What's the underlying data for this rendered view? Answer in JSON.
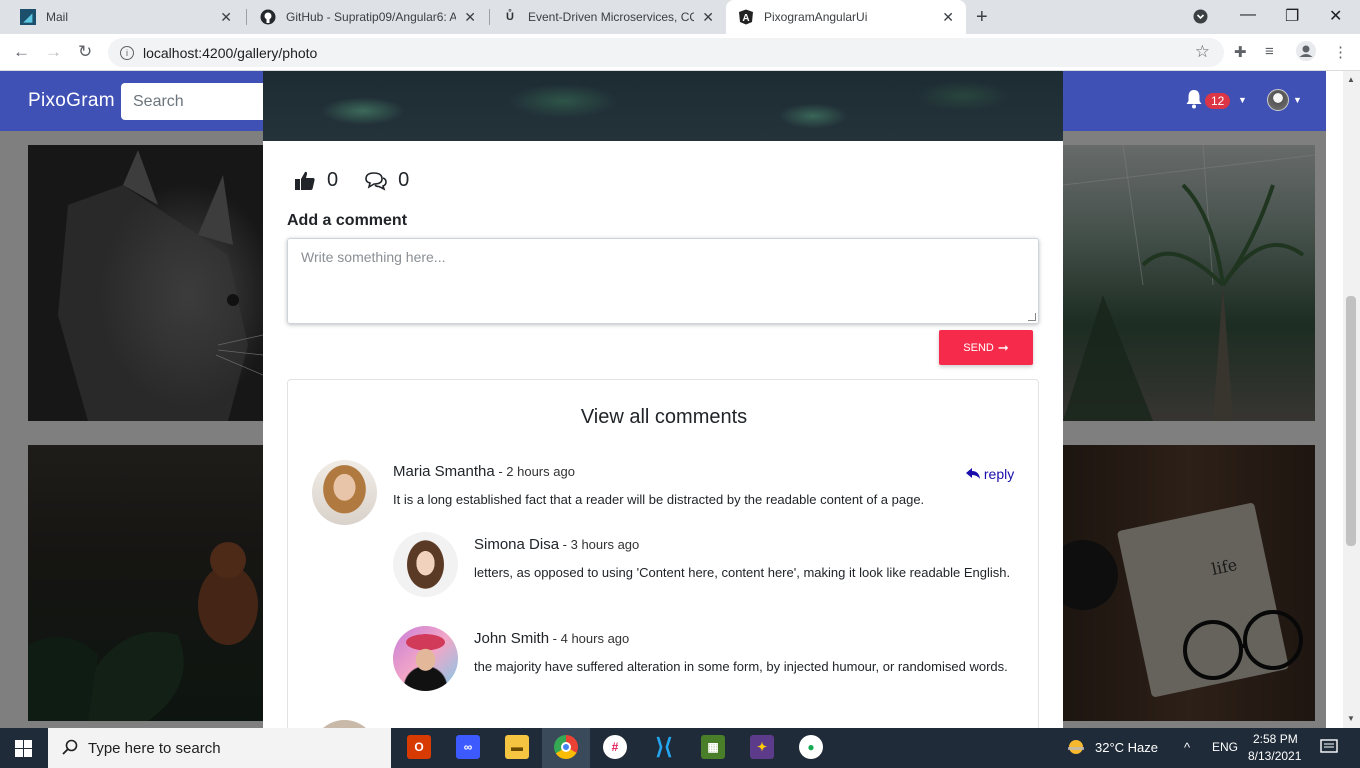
{
  "browser": {
    "tabs": [
      {
        "title": "Mail",
        "icon": "mail-icon",
        "active": false
      },
      {
        "title": "GitHub - Supratip09/Angular6: A",
        "icon": "github-icon",
        "active": false
      },
      {
        "title": "Event-Driven Microservices, CQR",
        "icon": "udemy-icon",
        "active": false
      },
      {
        "title": "PixogramAngularUi",
        "icon": "angular-icon",
        "active": true
      }
    ],
    "url": "localhost:4200/gallery/photo"
  },
  "app": {
    "brand": "PixoGram",
    "search_placeholder": "Search",
    "notification_count": "12"
  },
  "modal": {
    "likes": "0",
    "comments_count": "0",
    "add_comment_label": "Add a comment",
    "comment_placeholder": "Write something here...",
    "send_label": "SEND",
    "comments_title": "View all comments",
    "comments": [
      {
        "name": "Maria Smantha",
        "time": " - 2 hours ago",
        "text": "It is a long established fact that a reader will be distracted by the readable content of a page.",
        "reply_label": "reply"
      },
      {
        "name": "Simona Disa",
        "time": " - 3 hours ago",
        "text": "letters, as opposed to using 'Content here, content here', making it look like readable English."
      },
      {
        "name": "John Smith",
        "time": " - 4 hours ago",
        "text": "the majority have suffered alteration in some form, by injected humour, or randomised words."
      }
    ]
  },
  "taskbar": {
    "search_placeholder": "Type here to search",
    "weather": "32°C  Haze",
    "language": "ENG",
    "time": "2:58 PM",
    "date": "8/13/2021"
  }
}
